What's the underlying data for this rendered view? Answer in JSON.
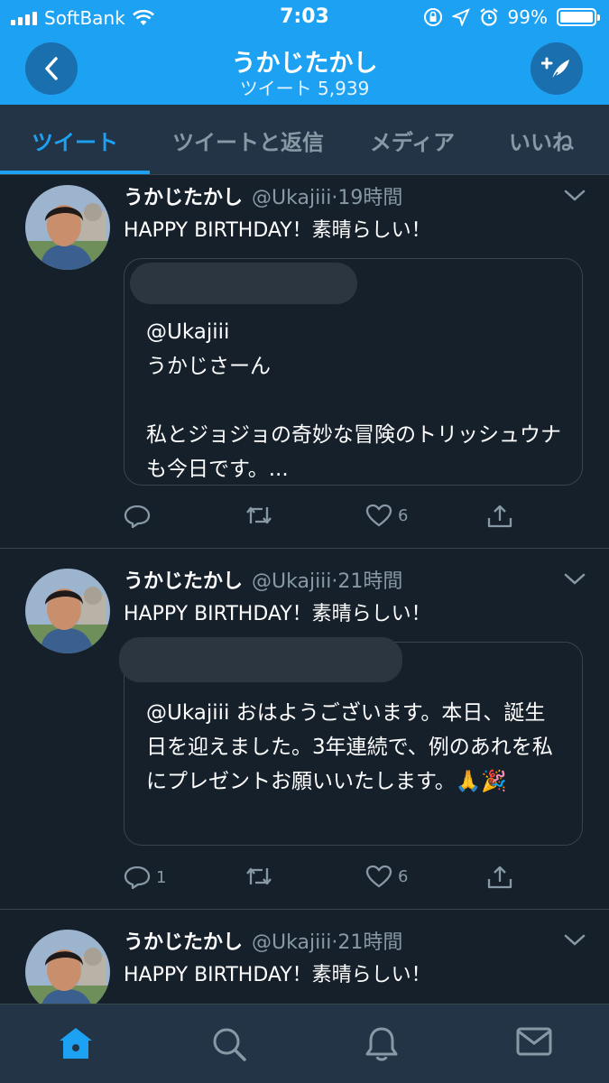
{
  "status": {
    "carrier": "SoftBank",
    "time": "7:03",
    "battery": "99%",
    "battery_level": 0.99
  },
  "header": {
    "title": "うかじたかし",
    "subtitle": "ツイート 5,939"
  },
  "tabs": [
    {
      "label": "ツイート"
    },
    {
      "label": "ツイートと返信"
    },
    {
      "label": "メディア"
    },
    {
      "label": "いいね"
    }
  ],
  "tweets": [
    {
      "name": "うかじたかし",
      "handle": "@Ukajiii",
      "dot": "·",
      "time": "19時間",
      "text": "HAPPY BIRTHDAY！素晴らしい！",
      "quote_text": "@Ukajiii\nうかじさーん\n\n私とジョジョの奇妙な冒険のトリッシュウナも今日です。...",
      "reply_count": "",
      "like_count": "6"
    },
    {
      "name": "うかじたかし",
      "handle": "@Ukajiii",
      "dot": "·",
      "time": "21時間",
      "text": "HAPPY BIRTHDAY！素晴らしい！",
      "quote_text": "@Ukajiii おはようございます。本日、誕生日を迎えました。3年連続で、例のあれを私にプレゼントお願いいたします。🙏🎉",
      "reply_count": "1",
      "like_count": "6"
    },
    {
      "name": "うかじたかし",
      "handle": "@Ukajiii",
      "dot": "·",
      "time": "21時間",
      "text": "HAPPY BIRTHDAY！素晴らしい！"
    }
  ],
  "colors": {
    "accent": "#1da1f2",
    "background": "#15202b",
    "surface": "#243447",
    "muted": "#8899a6",
    "border": "#38444d"
  },
  "icons": [
    "back-icon",
    "compose-icon",
    "reply-icon",
    "retweet-icon",
    "like-icon",
    "share-icon",
    "home-icon",
    "search-icon",
    "notifications-icon",
    "messages-icon",
    "chevron-down-icon"
  ]
}
